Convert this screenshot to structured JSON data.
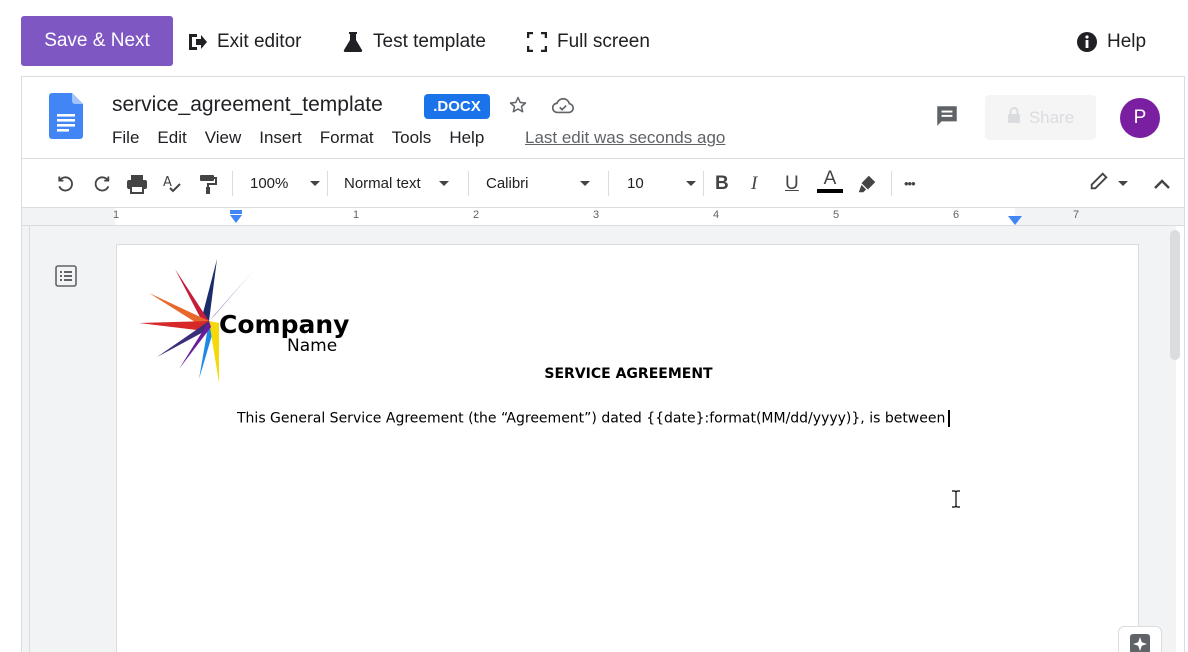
{
  "editor_bar": {
    "save_next": "Save & Next",
    "exit_editor": "Exit editor",
    "test_template": "Test template",
    "full_screen": "Full screen",
    "help": "Help",
    "accent_color": "#7e57c2"
  },
  "doc_header": {
    "title": "service_agreement_template",
    "badge": ".DOCX",
    "menu": [
      "File",
      "Edit",
      "View",
      "Insert",
      "Format",
      "Tools",
      "Help"
    ],
    "last_edit": "Last edit was seconds ago",
    "share_label": "Share",
    "avatar_initial": "P"
  },
  "toolbar": {
    "zoom": "100%",
    "style": "Normal text",
    "font": "Calibri",
    "font_size": "10",
    "more": "•••"
  },
  "ruler": {
    "numbers": [
      "1",
      "1",
      "2",
      "3",
      "4",
      "5",
      "6",
      "7"
    ]
  },
  "document": {
    "logo_line1": "Company",
    "logo_line2": "Name",
    "heading": "SERVICE AGREEMENT",
    "body": "This General Service Agreement (the “Agreement”) dated {{date}:format(MM/dd/yyyy)}, is between"
  },
  "icons": [
    "exit-icon",
    "flask-icon",
    "fullscreen-icon",
    "info-icon",
    "docs-logo",
    "star-icon",
    "cloud-check-icon",
    "comment-icon",
    "lock-icon",
    "undo-icon",
    "redo-icon",
    "print-icon",
    "spellcheck-icon",
    "paint-format-icon",
    "bold-icon",
    "italic-icon",
    "underline-icon",
    "text-color-icon",
    "highlight-icon",
    "edit-mode-icon",
    "collapse-icon",
    "outline-icon",
    "explore-icon",
    "ibeam-cursor-icon"
  ]
}
